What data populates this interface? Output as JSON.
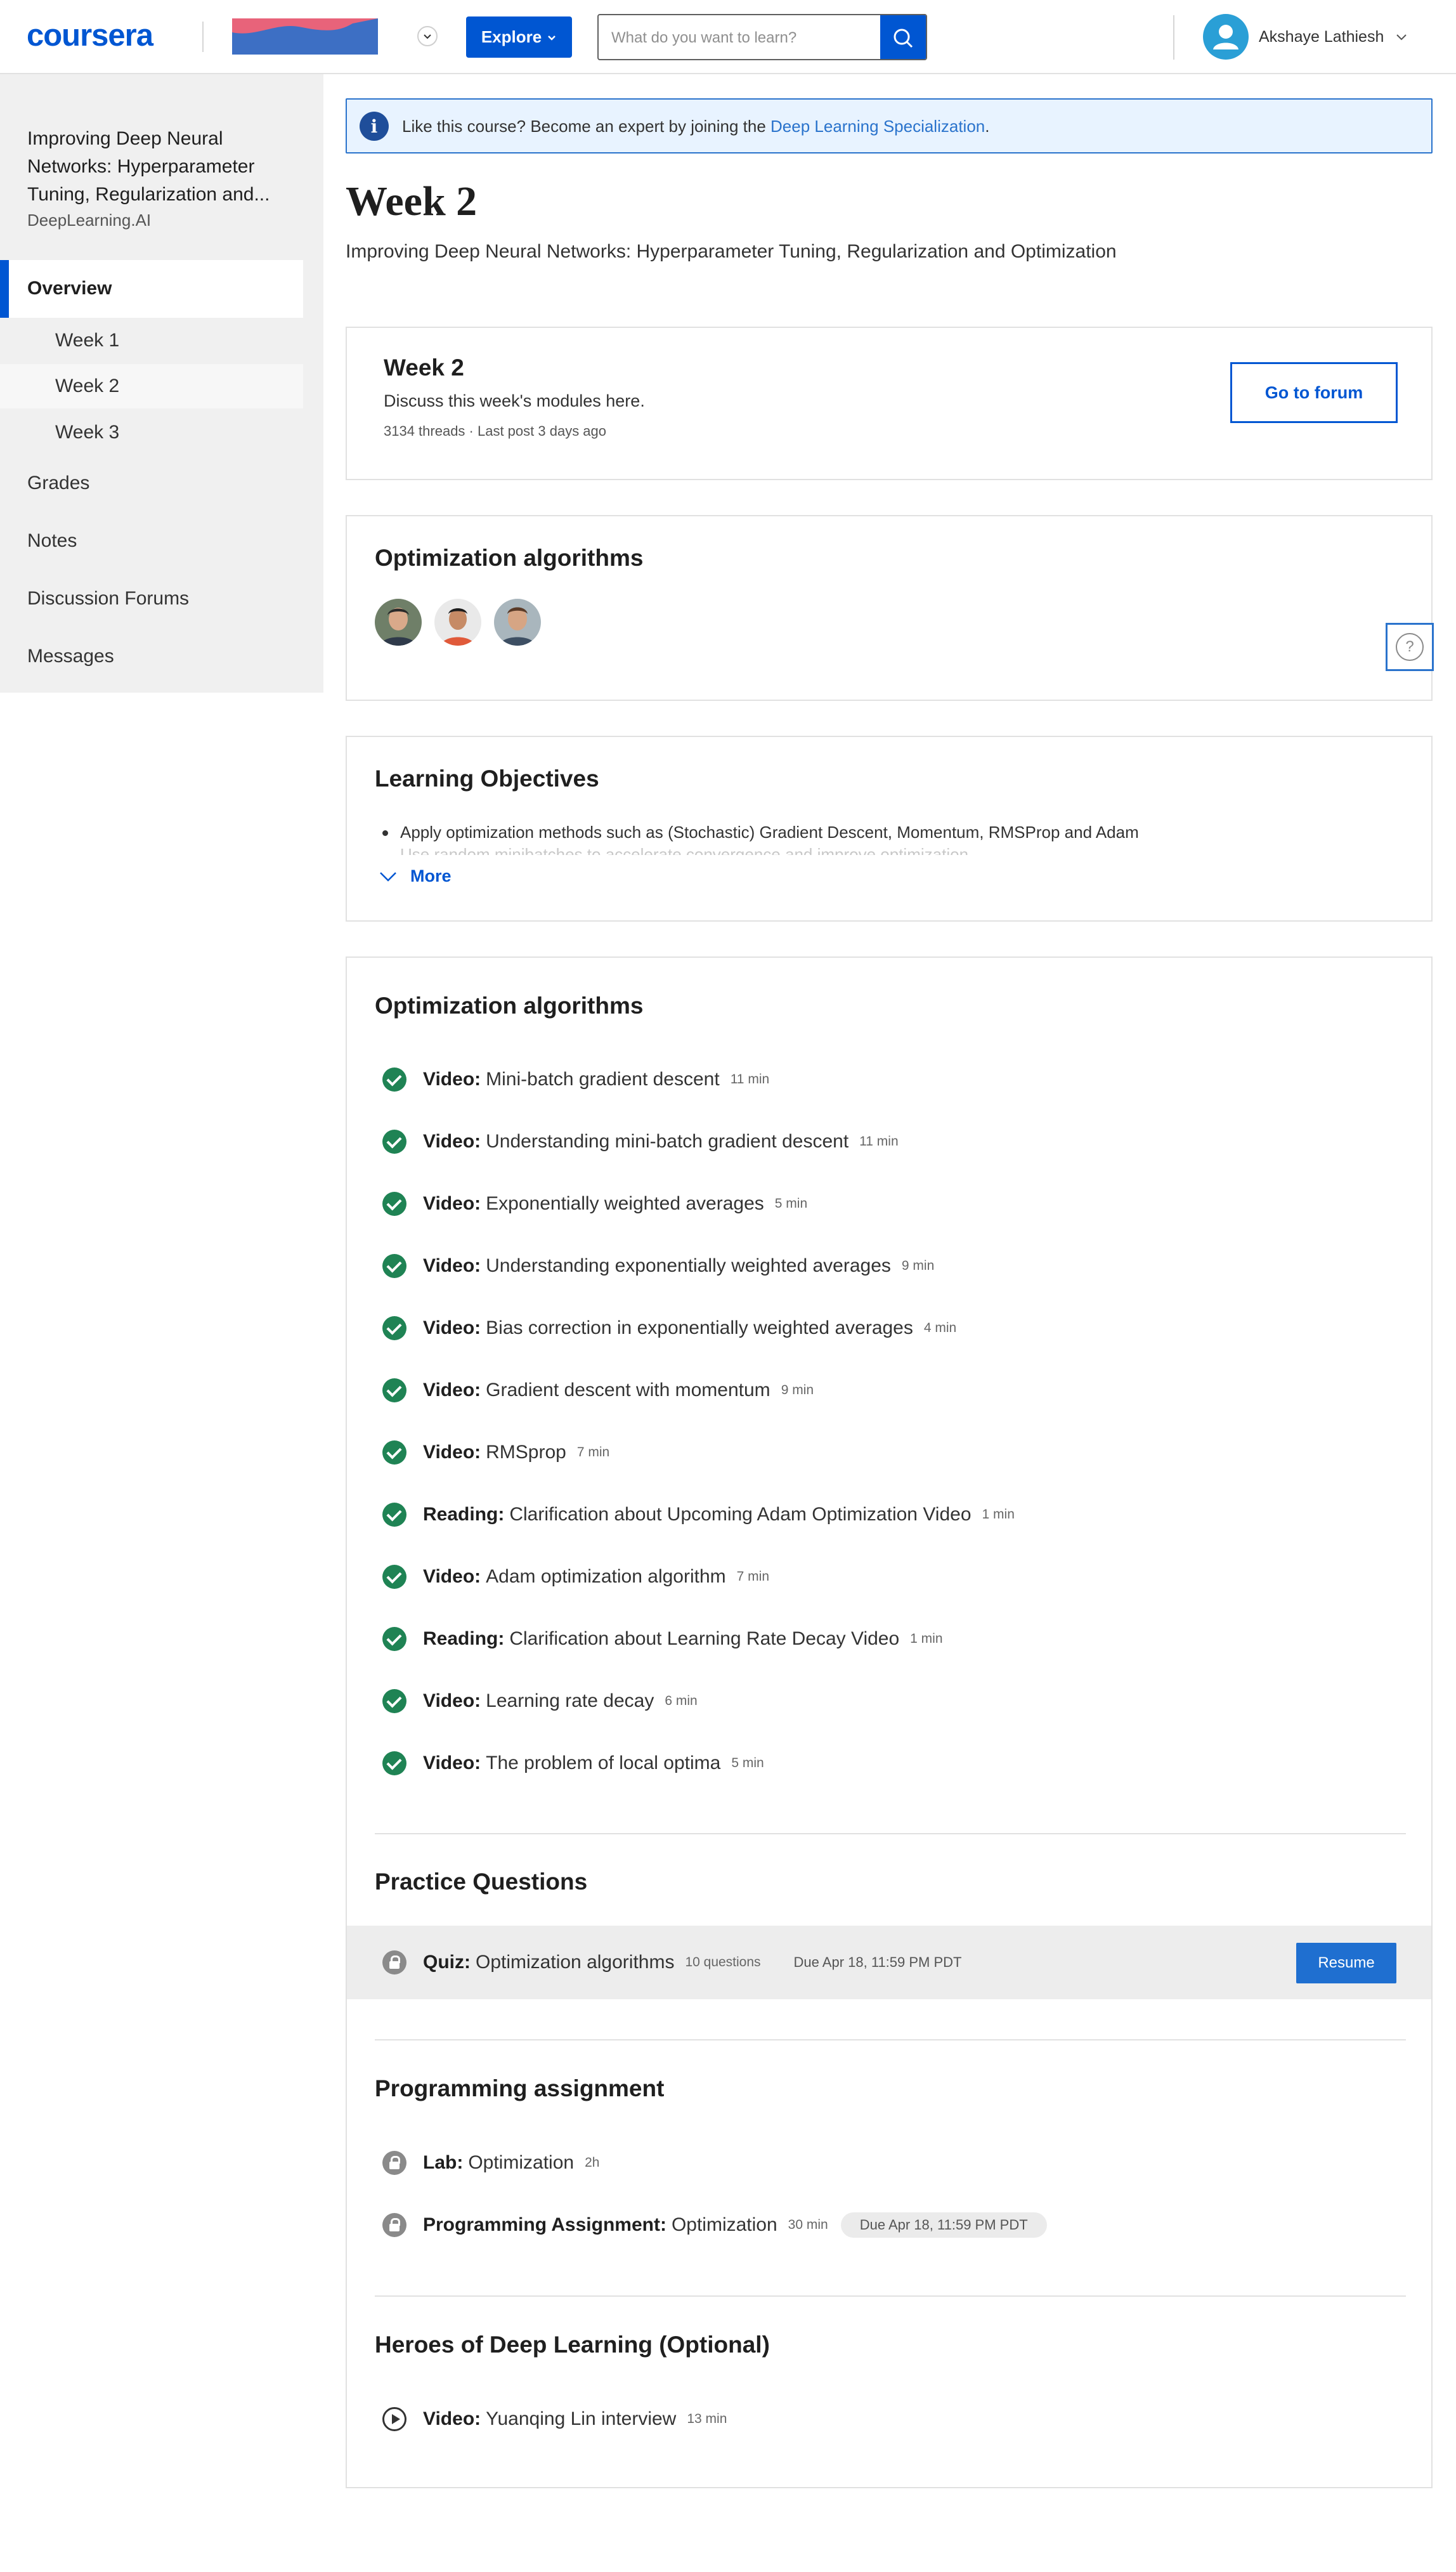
{
  "header": {
    "logo": "coursera",
    "explore_label": "Explore",
    "search_placeholder": "What do you want to learn?",
    "user_name": "Akshaye Lathiesh",
    "brand_color": "#0056d2"
  },
  "sidebar": {
    "course_title": "Improving Deep Neural Networks: Hyperparameter Tuning, Regularization and...",
    "org": "DeepLearning.AI",
    "overview_label": "Overview",
    "weeks": [
      "Week 1",
      "Week 2",
      "Week 3"
    ],
    "nav": [
      "Grades",
      "Notes",
      "Discussion Forums",
      "Messages"
    ]
  },
  "info_banner": {
    "text": "Like this course? Become an expert by joining the ",
    "link": "Deep Learning Specialization",
    "end": "."
  },
  "page": {
    "title": "Week 2",
    "subtitle": "Improving Deep Neural Networks: Hyperparameter Tuning, Regularization and Optimization"
  },
  "forum": {
    "title": "Week 2",
    "desc": "Discuss this week's modules here.",
    "meta": "3134 threads · Last post 3 days ago",
    "button": "Go to forum"
  },
  "instructors": {
    "title": "Optimization algorithms"
  },
  "objectives": {
    "title": "Learning Objectives",
    "items": [
      "Apply optimization methods such as (Stochastic) Gradient Descent, Momentum, RMSProp and Adam",
      "Use random minibatches to accelerate convergence and improve optimization"
    ],
    "more": "More"
  },
  "module": {
    "title": "Optimization algorithms",
    "items": [
      {
        "type": "Video:",
        "name": "Mini-batch gradient descent",
        "dur": "11 min"
      },
      {
        "type": "Video:",
        "name": "Understanding mini-batch gradient descent",
        "dur": "11 min"
      },
      {
        "type": "Video:",
        "name": "Exponentially weighted averages",
        "dur": "5 min"
      },
      {
        "type": "Video:",
        "name": "Understanding exponentially weighted averages",
        "dur": "9 min"
      },
      {
        "type": "Video:",
        "name": "Bias correction in exponentially weighted averages",
        "dur": "4 min"
      },
      {
        "type": "Video:",
        "name": "Gradient descent with momentum",
        "dur": "9 min"
      },
      {
        "type": "Video:",
        "name": "RMSprop",
        "dur": "7 min"
      },
      {
        "type": "Reading:",
        "name": "Clarification about Upcoming Adam Optimization Video",
        "dur": "1 min"
      },
      {
        "type": "Video:",
        "name": "Adam optimization algorithm",
        "dur": "7 min"
      },
      {
        "type": "Reading:",
        "name": "Clarification about Learning Rate Decay Video",
        "dur": "1 min"
      },
      {
        "type": "Video:",
        "name": "Learning rate decay",
        "dur": "6 min"
      },
      {
        "type": "Video:",
        "name": "The problem of local optima",
        "dur": "5 min"
      }
    ]
  },
  "practice": {
    "title": "Practice Questions",
    "quiz_type": "Quiz:",
    "quiz_name": "Optimization algorithms",
    "quiz_meta": "10 questions",
    "quiz_due": "Due Apr 18, 11:59 PM PDT",
    "resume": "Resume"
  },
  "programming": {
    "title": "Programming assignment",
    "lab_type": "Lab:",
    "lab_name": "Optimization",
    "lab_dur": "2h",
    "pa_type": "Programming Assignment:",
    "pa_name": "Optimization",
    "pa_dur": "30 min",
    "pa_due": "Due Apr 18, 11:59 PM PDT"
  },
  "heroes": {
    "title": "Heroes of Deep Learning (Optional)",
    "type": "Video:",
    "name": "Yuanqing Lin interview",
    "dur": "13 min"
  }
}
